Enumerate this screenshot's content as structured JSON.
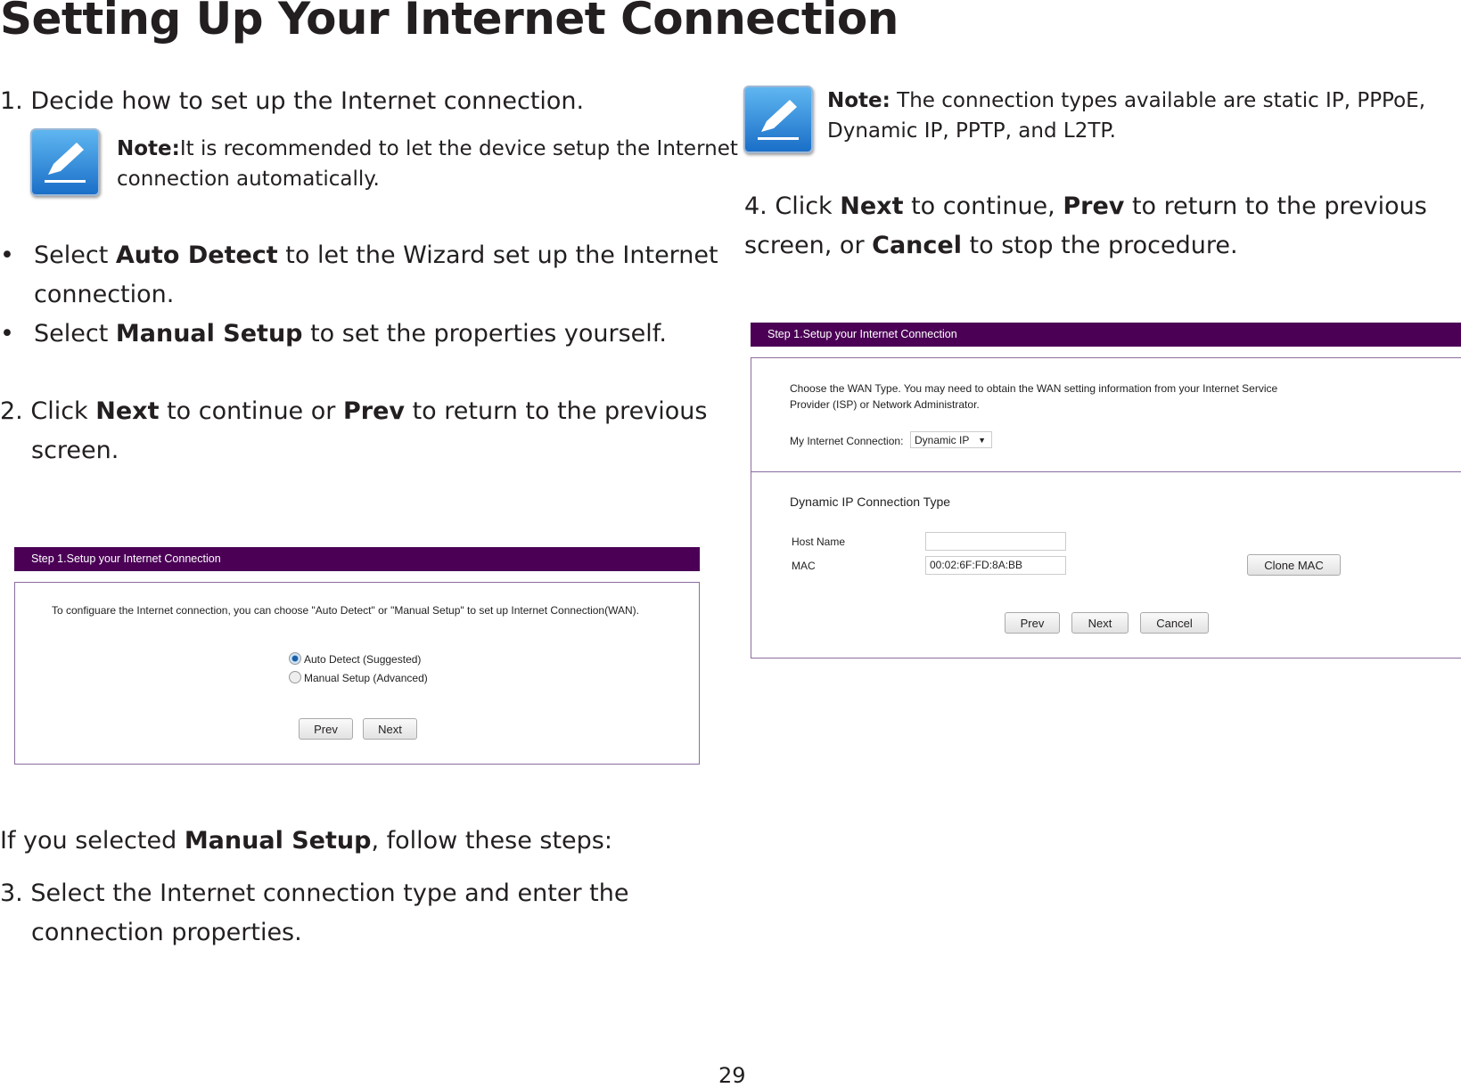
{
  "title": "Setting Up Your Internet Connection",
  "step1": "1. Decide how to set up the Internet connection.",
  "note1": {
    "label": "Note:",
    "line1": "It is recommended to let the device setup the Internet",
    "line2": "connection automatically."
  },
  "bullets": [
    {
      "pre": "Select ",
      "bold": "Auto Detect",
      "post": " to let the Wizard set up the Internet",
      "cont": "connection."
    },
    {
      "pre": "Select ",
      "bold": "Manual Setup",
      "post": " to set the properties yourself."
    }
  ],
  "step2": {
    "pre": "2. Click ",
    "b1": "Next",
    "mid": " to continue or ",
    "b2": "Prev",
    "post": " to return to the previous",
    "cont": "screen."
  },
  "panel1": {
    "header": "Step 1.Setup your Internet Connection",
    "desc": "To configuare the Internet connection, you can choose \"Auto Detect\" or \"Manual Setup\" to set up Internet Connection(WAN).",
    "options": [
      {
        "label": "Auto Detect (Suggested)",
        "selected": true
      },
      {
        "label": "Manual Setup (Advanced)",
        "selected": false
      }
    ],
    "prev": "Prev",
    "next": "Next"
  },
  "manual": {
    "pre": "If you selected ",
    "bold": "Manual Setup",
    "post": ", follow these steps:"
  },
  "step3": {
    "line1": "3. Select the Internet connection type and enter the",
    "line2": "connection properties."
  },
  "note2": {
    "label": "Note:",
    "line1": " The connection types available are static IP, PPPoE,",
    "line2": "Dynamic IP, PPTP, and L2TP."
  },
  "step4": {
    "pre": "4. Click ",
    "b1": "Next",
    "mid": " to continue, ",
    "b2": "Prev",
    "post": " to return to the previous",
    "l2pre": "screen, or ",
    "b3": "Cancel",
    "l2post": " to stop the procedure."
  },
  "panel2": {
    "header": "Step 1.Setup your Internet Connection",
    "desc1": "Choose the WAN Type. You may need to obtain the WAN setting information from your Internet Service",
    "desc2": "Provider (ISP) or Network Administrator.",
    "conn_label": "My Internet Connection:",
    "conn_value": "Dynamic IP",
    "section": "Dynamic IP Connection Type",
    "host_label": "Host Name",
    "host_value": "",
    "mac_label": "MAC",
    "mac_value": "00:02:6F:FD:8A:BB",
    "clone": "Clone MAC",
    "prev": "Prev",
    "next": "Next",
    "cancel": "Cancel"
  },
  "page_number": "29"
}
